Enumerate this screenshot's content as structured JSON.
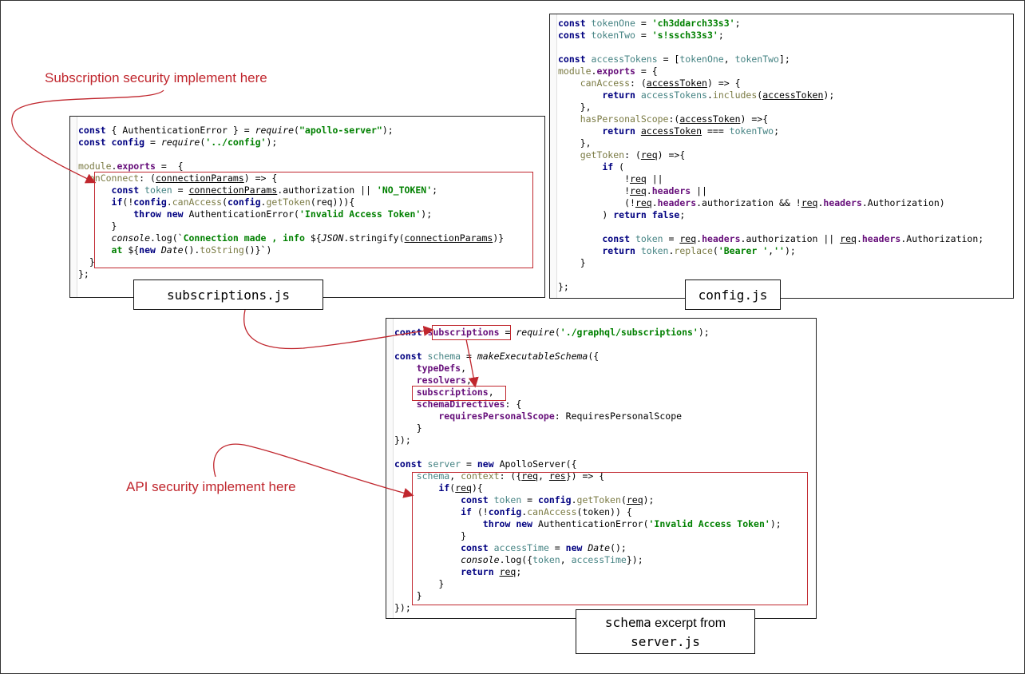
{
  "annotations": {
    "subscription_security": "Subscription security implement here",
    "api_security": "API security implement here"
  },
  "labels": {
    "subscriptions_file": "subscriptions.js",
    "config_file": "config.js",
    "schema_line1_mono": "schema",
    "schema_line1_text": " excerpt from",
    "schema_line2": "server.js"
  },
  "colors": {
    "annotation": "#c0262d",
    "keyword": "#000080",
    "string": "#008000",
    "variable": "#458383",
    "property": "#660e7a"
  },
  "subscriptions_code": [
    [
      [
        "kw",
        "const"
      ],
      [
        "plain",
        " { AuthenticationError } = "
      ],
      [
        "it",
        "require"
      ],
      [
        "plain",
        "("
      ],
      [
        "str",
        "\"apollo-server\""
      ],
      [
        "plain",
        ");"
      ]
    ],
    [
      [
        "kw",
        "const config"
      ],
      [
        "plain",
        " = "
      ],
      [
        "it",
        "require"
      ],
      [
        "plain",
        "("
      ],
      [
        "str",
        "'../config'"
      ],
      [
        "plain",
        ");"
      ]
    ],
    [],
    [
      [
        "fn",
        "module"
      ],
      [
        "plain",
        "."
      ],
      [
        "prop",
        "exports"
      ],
      [
        "plain",
        " =  {"
      ]
    ],
    [
      [
        "fn",
        "  onConnect"
      ],
      [
        "plain",
        ": ("
      ],
      [
        "ul",
        "connectionParams"
      ],
      [
        "plain",
        ") => {"
      ]
    ],
    [
      [
        "kw",
        "      const"
      ],
      [
        "var",
        " token"
      ],
      [
        "plain",
        " = "
      ],
      [
        "ul",
        "connectionParams"
      ],
      [
        "plain",
        ".authorization || "
      ],
      [
        "str",
        "'NO_TOKEN'"
      ],
      [
        "plain",
        ";"
      ]
    ],
    [
      [
        "kw",
        "      if"
      ],
      [
        "plain",
        "(!"
      ],
      [
        "kw",
        "config"
      ],
      [
        "plain",
        "."
      ],
      [
        "fn",
        "canAccess"
      ],
      [
        "plain",
        "("
      ],
      [
        "kw",
        "config"
      ],
      [
        "plain",
        "."
      ],
      [
        "fn",
        "getToken"
      ],
      [
        "plain",
        "(req))){"
      ]
    ],
    [
      [
        "kw",
        "          throw new"
      ],
      [
        "plain",
        " AuthenticationError("
      ],
      [
        "str",
        "'Invalid Access Token'"
      ],
      [
        "plain",
        ");"
      ]
    ],
    [
      [
        "plain",
        "      }"
      ]
    ],
    [
      [
        "prop",
        "      "
      ],
      [
        "it",
        "console"
      ],
      [
        "plain",
        ".log(`"
      ],
      [
        "str",
        "Connection made , info "
      ],
      [
        "plain",
        "${"
      ],
      [
        "it",
        "JSON"
      ],
      [
        "plain",
        ".stringify("
      ],
      [
        "ul",
        "connectionParams"
      ],
      [
        "plain",
        ")}"
      ]
    ],
    [
      [
        "str",
        "      at "
      ],
      [
        "plain",
        "${"
      ],
      [
        "kw",
        "new "
      ],
      [
        "it",
        "Date"
      ],
      [
        "plain",
        "()."
      ],
      [
        "fn",
        "toString"
      ],
      [
        "plain",
        "()}`)"
      ]
    ],
    [
      [
        "plain",
        "  }"
      ]
    ],
    [
      [
        "plain",
        "};"
      ]
    ]
  ],
  "config_code": [
    [
      [
        "kw",
        "const"
      ],
      [
        "var",
        " tokenOne"
      ],
      [
        "plain",
        " = "
      ],
      [
        "str",
        "'ch3ddarch33s3'"
      ],
      [
        "plain",
        ";"
      ]
    ],
    [
      [
        "kw",
        "const"
      ],
      [
        "var",
        " tokenTwo"
      ],
      [
        "plain",
        " = "
      ],
      [
        "str",
        "'s!ssch33s3'"
      ],
      [
        "plain",
        ";"
      ]
    ],
    [],
    [
      [
        "kw",
        "const"
      ],
      [
        "var",
        " accessTokens"
      ],
      [
        "plain",
        " = ["
      ],
      [
        "var",
        "tokenOne"
      ],
      [
        "plain",
        ", "
      ],
      [
        "var",
        "tokenTwo"
      ],
      [
        "plain",
        "];"
      ]
    ],
    [
      [
        "fn",
        "module"
      ],
      [
        "plain",
        "."
      ],
      [
        "prop",
        "exports"
      ],
      [
        "plain",
        " = {"
      ]
    ],
    [
      [
        "fn",
        "    canAccess"
      ],
      [
        "plain",
        ": ("
      ],
      [
        "ul",
        "accessToken"
      ],
      [
        "plain",
        ") => {"
      ]
    ],
    [
      [
        "kw",
        "        return"
      ],
      [
        "var",
        " accessTokens"
      ],
      [
        "plain",
        "."
      ],
      [
        "fn",
        "includes"
      ],
      [
        "plain",
        "("
      ],
      [
        "ul",
        "accessToken"
      ],
      [
        "plain",
        ");"
      ]
    ],
    [
      [
        "plain",
        "    },"
      ]
    ],
    [
      [
        "fn",
        "    hasPersonalScope"
      ],
      [
        "plain",
        ":("
      ],
      [
        "ul",
        "accessToken"
      ],
      [
        "plain",
        ") =>{"
      ]
    ],
    [
      [
        "kw",
        "        return"
      ],
      [
        "plain",
        " "
      ],
      [
        "ul",
        "accessToken"
      ],
      [
        "plain",
        " === "
      ],
      [
        "var",
        "tokenTwo"
      ],
      [
        "plain",
        ";"
      ]
    ],
    [
      [
        "plain",
        "    },"
      ]
    ],
    [
      [
        "fn",
        "    getToken"
      ],
      [
        "plain",
        ": ("
      ],
      [
        "ul",
        "req"
      ],
      [
        "plain",
        ") =>{"
      ]
    ],
    [
      [
        "kw",
        "        if"
      ],
      [
        "plain",
        " ("
      ]
    ],
    [
      [
        "plain",
        "            !"
      ],
      [
        "ul",
        "req"
      ],
      [
        "plain",
        " ||"
      ]
    ],
    [
      [
        "plain",
        "            !"
      ],
      [
        "ul",
        "req"
      ],
      [
        "plain",
        "."
      ],
      [
        "prop",
        "headers"
      ],
      [
        "plain",
        " ||"
      ]
    ],
    [
      [
        "plain",
        "            (!"
      ],
      [
        "ul",
        "req"
      ],
      [
        "plain",
        "."
      ],
      [
        "prop",
        "headers"
      ],
      [
        "plain",
        ".authorization && !"
      ],
      [
        "ul",
        "req"
      ],
      [
        "plain",
        "."
      ],
      [
        "prop",
        "headers"
      ],
      [
        "plain",
        ".Authorization)"
      ]
    ],
    [
      [
        "plain",
        "        ) "
      ],
      [
        "kw",
        "return false"
      ],
      [
        "plain",
        ";"
      ]
    ],
    [],
    [
      [
        "kw",
        "        const"
      ],
      [
        "var",
        " token"
      ],
      [
        "plain",
        " = "
      ],
      [
        "ul",
        "req"
      ],
      [
        "plain",
        "."
      ],
      [
        "prop",
        "headers"
      ],
      [
        "plain",
        ".authorization || "
      ],
      [
        "ul",
        "req"
      ],
      [
        "plain",
        "."
      ],
      [
        "prop",
        "headers"
      ],
      [
        "plain",
        ".Authorization;"
      ]
    ],
    [
      [
        "kw",
        "        return"
      ],
      [
        "var",
        " token"
      ],
      [
        "plain",
        "."
      ],
      [
        "fn",
        "replace"
      ],
      [
        "plain",
        "("
      ],
      [
        "str",
        "'Bearer '"
      ],
      [
        "plain",
        ","
      ],
      [
        "str",
        "''"
      ],
      [
        "plain",
        ");"
      ]
    ],
    [
      [
        "plain",
        "    }"
      ]
    ],
    [],
    [
      [
        "plain",
        "};"
      ]
    ]
  ],
  "server_code": [
    [
      [
        "kw",
        "const"
      ],
      [
        "plain",
        " "
      ],
      [
        "prop",
        "subscriptions"
      ],
      [
        "plain",
        " = "
      ],
      [
        "it",
        "require"
      ],
      [
        "plain",
        "("
      ],
      [
        "str",
        "'./graphql/subscriptions'"
      ],
      [
        "plain",
        ");"
      ]
    ],
    [],
    [
      [
        "kw",
        "const"
      ],
      [
        "var",
        " schema"
      ],
      [
        "plain",
        " = "
      ],
      [
        "it",
        "makeExecutableSchema"
      ],
      [
        "plain",
        "({"
      ]
    ],
    [
      [
        "prop",
        "    typeDefs"
      ],
      [
        "plain",
        ","
      ]
    ],
    [
      [
        "prop",
        "    resolvers"
      ],
      [
        "plain",
        ","
      ]
    ],
    [
      [
        "prop",
        "    subscriptions"
      ],
      [
        "plain",
        ","
      ]
    ],
    [
      [
        "prop",
        "    schemaDirectives"
      ],
      [
        "plain",
        ": {"
      ]
    ],
    [
      [
        "prop",
        "        requiresPersonalScope"
      ],
      [
        "plain",
        ": RequiresPersonalScope"
      ]
    ],
    [
      [
        "plain",
        "    }"
      ]
    ],
    [
      [
        "plain",
        "});"
      ]
    ],
    [],
    [
      [
        "kw",
        "const"
      ],
      [
        "var",
        " server"
      ],
      [
        "plain",
        " = "
      ],
      [
        "kw",
        "new"
      ],
      [
        "plain",
        " ApolloServer({"
      ]
    ],
    [
      [
        "var",
        "    schema"
      ],
      [
        "plain",
        ", "
      ],
      [
        "fn",
        "context"
      ],
      [
        "plain",
        ": ({"
      ],
      [
        "ul",
        "req"
      ],
      [
        "plain",
        ", "
      ],
      [
        "ul",
        "res"
      ],
      [
        "plain",
        "}) => {"
      ]
    ],
    [
      [
        "kw",
        "        if"
      ],
      [
        "plain",
        "("
      ],
      [
        "ul",
        "req"
      ],
      [
        "plain",
        "){"
      ]
    ],
    [
      [
        "kw",
        "            const"
      ],
      [
        "var",
        " token"
      ],
      [
        "plain",
        " = "
      ],
      [
        "kw",
        "config"
      ],
      [
        "plain",
        "."
      ],
      [
        "fn",
        "getToken"
      ],
      [
        "plain",
        "("
      ],
      [
        "ul",
        "req"
      ],
      [
        "plain",
        ");"
      ]
    ],
    [
      [
        "kw",
        "            if"
      ],
      [
        "plain",
        " (!"
      ],
      [
        "kw",
        "config"
      ],
      [
        "plain",
        "."
      ],
      [
        "fn",
        "canAccess"
      ],
      [
        "plain",
        "(token)) {"
      ]
    ],
    [
      [
        "kw",
        "                throw new"
      ],
      [
        "plain",
        " AuthenticationError("
      ],
      [
        "str",
        "'Invalid Access Token'"
      ],
      [
        "plain",
        ");"
      ]
    ],
    [
      [
        "plain",
        "            }"
      ]
    ],
    [
      [
        "kw",
        "            const"
      ],
      [
        "var",
        " accessTime"
      ],
      [
        "plain",
        " = "
      ],
      [
        "kw",
        "new "
      ],
      [
        "it",
        "Date"
      ],
      [
        "plain",
        "();"
      ]
    ],
    [
      [
        "prop",
        "            "
      ],
      [
        "it",
        "console"
      ],
      [
        "plain",
        ".log({"
      ],
      [
        "var",
        "token"
      ],
      [
        "plain",
        ", "
      ],
      [
        "var",
        "accessTime"
      ],
      [
        "plain",
        "});"
      ]
    ],
    [
      [
        "kw",
        "            return"
      ],
      [
        "plain",
        " "
      ],
      [
        "ul",
        "req"
      ],
      [
        "plain",
        ";"
      ]
    ],
    [
      [
        "plain",
        "        }"
      ]
    ],
    [
      [
        "plain",
        "    }"
      ]
    ],
    [
      [
        "plain",
        "});"
      ]
    ]
  ]
}
